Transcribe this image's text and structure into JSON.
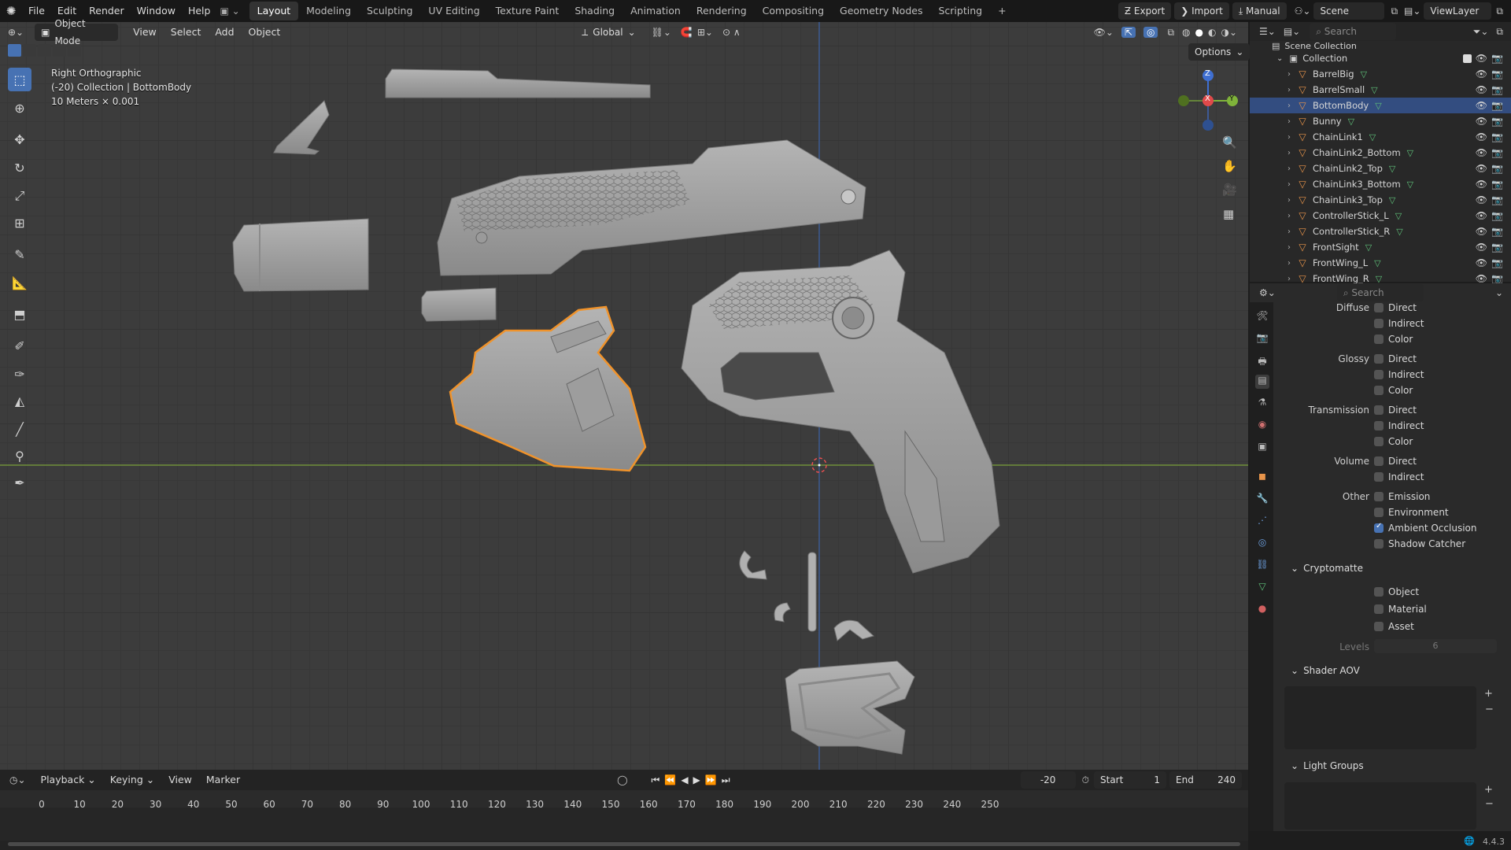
{
  "topbar": {
    "menus": [
      "File",
      "Edit",
      "Render",
      "Window",
      "Help"
    ],
    "workspaces": [
      "Layout",
      "Modeling",
      "Sculpting",
      "UV Editing",
      "Texture Paint",
      "Shading",
      "Animation",
      "Rendering",
      "Compositing",
      "Geometry Nodes",
      "Scripting"
    ],
    "active_workspace": "Layout",
    "export_label": "Export",
    "import_label": "Import",
    "manual_label": "Manual",
    "scene_label": "Scene",
    "viewlayer_label": "ViewLayer"
  },
  "viewport_header": {
    "mode": "Object Mode",
    "menus": [
      "View",
      "Select",
      "Add",
      "Object"
    ],
    "orientation": "Global",
    "options_label": "Options"
  },
  "viewport_overlay": {
    "view_name": "Right Orthographic",
    "collection_info": "(-20) Collection | BottomBody",
    "scale_info": "10 Meters × 0.001"
  },
  "gizmo": {
    "z": "Z",
    "x": "X",
    "y": "Y"
  },
  "outliner": {
    "search_placeholder": "Search",
    "scene_collection": "Scene Collection",
    "collection": "Collection",
    "items": [
      {
        "name": "BarrelBig",
        "selected": false
      },
      {
        "name": "BarrelSmall",
        "selected": false
      },
      {
        "name": "BottomBody",
        "selected": true
      },
      {
        "name": "Bunny",
        "selected": false
      },
      {
        "name": "ChainLink1",
        "selected": false
      },
      {
        "name": "ChainLink2_Bottom",
        "selected": false
      },
      {
        "name": "ChainLink2_Top",
        "selected": false
      },
      {
        "name": "ChainLink3_Bottom",
        "selected": false
      },
      {
        "name": "ChainLink3_Top",
        "selected": false
      },
      {
        "name": "ControllerStick_L",
        "selected": false
      },
      {
        "name": "ControllerStick_R",
        "selected": false
      },
      {
        "name": "FrontSight",
        "selected": false
      },
      {
        "name": "FrontWing_L",
        "selected": false
      },
      {
        "name": "FrontWing_R",
        "selected": false
      }
    ]
  },
  "properties": {
    "search_placeholder": "Search",
    "diffuse": "Diffuse",
    "glossy": "Glossy",
    "transmission": "Transmission",
    "volume": "Volume",
    "other": "Other",
    "direct": "Direct",
    "indirect": "Indirect",
    "color": "Color",
    "emission": "Emission",
    "environment": "Environment",
    "ambient_occlusion": "Ambient Occlusion",
    "shadow_catcher": "Shadow Catcher",
    "cryptomatte": "Cryptomatte",
    "object": "Object",
    "material": "Material",
    "asset": "Asset",
    "levels_label": "Levels",
    "levels_value": "6",
    "shader_aov": "Shader AOV",
    "light_groups": "Light Groups"
  },
  "timeline": {
    "playback": "Playback",
    "keying": "Keying",
    "view": "View",
    "marker": "Marker",
    "current_frame": "-20",
    "start_label": "Start",
    "start_value": "1",
    "end_label": "End",
    "end_value": "240",
    "ticks": [
      "0",
      "10",
      "20",
      "30",
      "40",
      "50",
      "60",
      "70",
      "80",
      "90",
      "100",
      "110",
      "120",
      "130",
      "140",
      "150",
      "160",
      "170",
      "180",
      "190",
      "200",
      "210",
      "220",
      "230",
      "240",
      "250"
    ]
  },
  "status": {
    "version": "4.4.3"
  },
  "colors": {
    "accent": "#4772b3",
    "selection_outline": "#f0932b",
    "mesh_icon": "#e8944a"
  }
}
